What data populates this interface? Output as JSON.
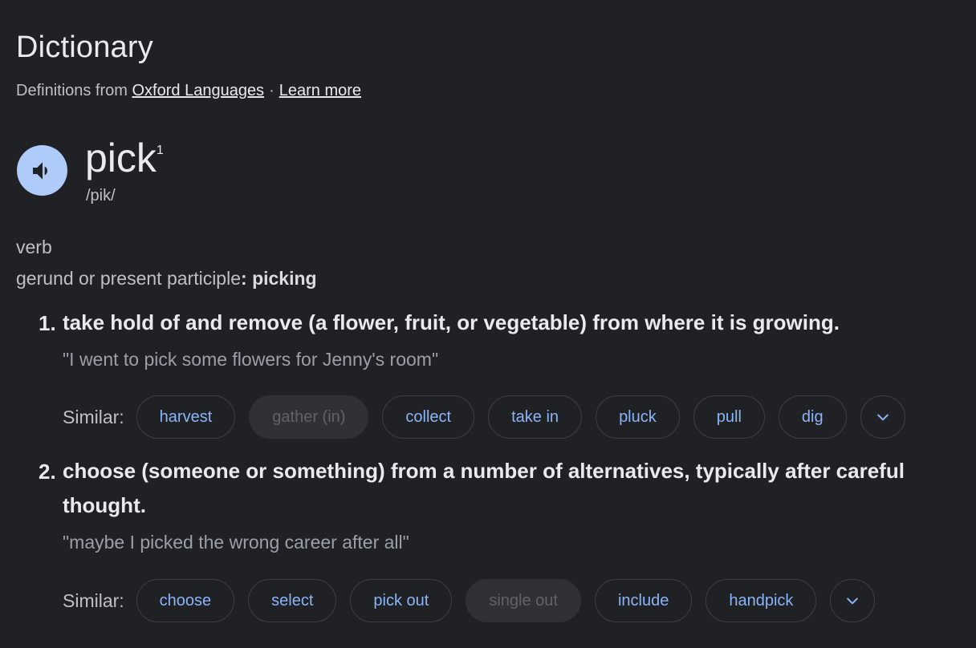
{
  "header": {
    "title": "Dictionary",
    "source_prefix": "Definitions from",
    "source_link": "Oxford Languages",
    "separator": "·",
    "learn_more": "Learn more"
  },
  "entry": {
    "word": "pick",
    "superscript": "1",
    "phonetic": "/pik/",
    "part_of_speech": "verb",
    "inflection_label": "gerund or present participle",
    "inflection_colon": ":",
    "inflection_value": "picking"
  },
  "senses": [
    {
      "number": "1.",
      "definition": "take hold of and remove (a flower, fruit, or vegetable) from where it is growing.",
      "example": "\"I went to pick some flowers for Jenny's room\"",
      "similar_label": "Similar:",
      "similar": [
        "harvest",
        "gather (in)",
        "collect",
        "take in",
        "pluck",
        "pull",
        "dig"
      ],
      "disabled_index": 1
    },
    {
      "number": "2.",
      "definition": "choose (someone or something) from a number of alternatives, typically after careful thought.",
      "example": "\"maybe I picked the wrong career after all\"",
      "similar_label": "Similar:",
      "similar": [
        "choose",
        "select",
        "pick out",
        "single out",
        "include",
        "handpick"
      ],
      "disabled_index": 3
    }
  ],
  "icons": {
    "speaker": "speaker-icon",
    "expand": "chevron-down-icon"
  },
  "colors": {
    "background": "#202124",
    "chip_text": "#8ab4f8",
    "speaker_bg": "#aecbfa"
  }
}
